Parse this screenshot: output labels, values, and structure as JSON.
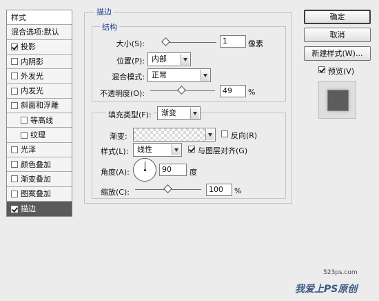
{
  "sidebar": {
    "title": "样式",
    "items": [
      {
        "label": "混合选项:默认",
        "has_checkbox": false,
        "checked": false,
        "indent": false,
        "selected": false
      },
      {
        "label": "投影",
        "has_checkbox": true,
        "checked": true,
        "indent": false,
        "selected": false
      },
      {
        "label": "内阴影",
        "has_checkbox": true,
        "checked": false,
        "indent": false,
        "selected": false
      },
      {
        "label": "外发光",
        "has_checkbox": true,
        "checked": false,
        "indent": false,
        "selected": false
      },
      {
        "label": "内发光",
        "has_checkbox": true,
        "checked": false,
        "indent": false,
        "selected": false
      },
      {
        "label": "斜面和浮雕",
        "has_checkbox": true,
        "checked": false,
        "indent": false,
        "selected": false
      },
      {
        "label": "等高线",
        "has_checkbox": true,
        "checked": false,
        "indent": true,
        "selected": false
      },
      {
        "label": "纹理",
        "has_checkbox": true,
        "checked": false,
        "indent": true,
        "selected": false
      },
      {
        "label": "光泽",
        "has_checkbox": true,
        "checked": false,
        "indent": false,
        "selected": false
      },
      {
        "label": "颜色叠加",
        "has_checkbox": true,
        "checked": false,
        "indent": false,
        "selected": false
      },
      {
        "label": "渐变叠加",
        "has_checkbox": true,
        "checked": false,
        "indent": false,
        "selected": false
      },
      {
        "label": "图案叠加",
        "has_checkbox": true,
        "checked": false,
        "indent": false,
        "selected": false
      },
      {
        "label": "描边",
        "has_checkbox": true,
        "checked": true,
        "indent": false,
        "selected": true
      }
    ]
  },
  "stroke": {
    "title": "描边",
    "structure": {
      "title": "结构",
      "size_label": "大小(S):",
      "size_value": "1",
      "size_unit": "像素",
      "size_fraction": 0.02,
      "position_label": "位置(P):",
      "position_value": "内部",
      "blend_label": "混合模式:",
      "blend_value": "正常",
      "opacity_label": "不透明度(O):",
      "opacity_value": "49",
      "opacity_unit": "%",
      "opacity_fraction": 0.49
    },
    "fill": {
      "fill_type_label": "填充类型(F):",
      "fill_type_value": "渐变",
      "gradient_label": "渐变:",
      "reverse_label": "反向(R)",
      "reverse_checked": false,
      "style_label": "样式(L):",
      "style_value": "线性",
      "align_label": "与图层对齐(G)",
      "align_checked": true,
      "angle_label": "角度(A):",
      "angle_value": "90",
      "angle_unit": "度",
      "scale_label": "缩放(C):",
      "scale_value": "100",
      "scale_unit": "%",
      "scale_fraction": 0.5
    }
  },
  "buttons": {
    "ok": "确定",
    "cancel": "取消",
    "new_style": "新建样式(W)...",
    "preview_label": "预览(V)",
    "preview_checked": true
  },
  "watermark": {
    "site": "523ps.com",
    "brand": "我爱上PS原创"
  }
}
